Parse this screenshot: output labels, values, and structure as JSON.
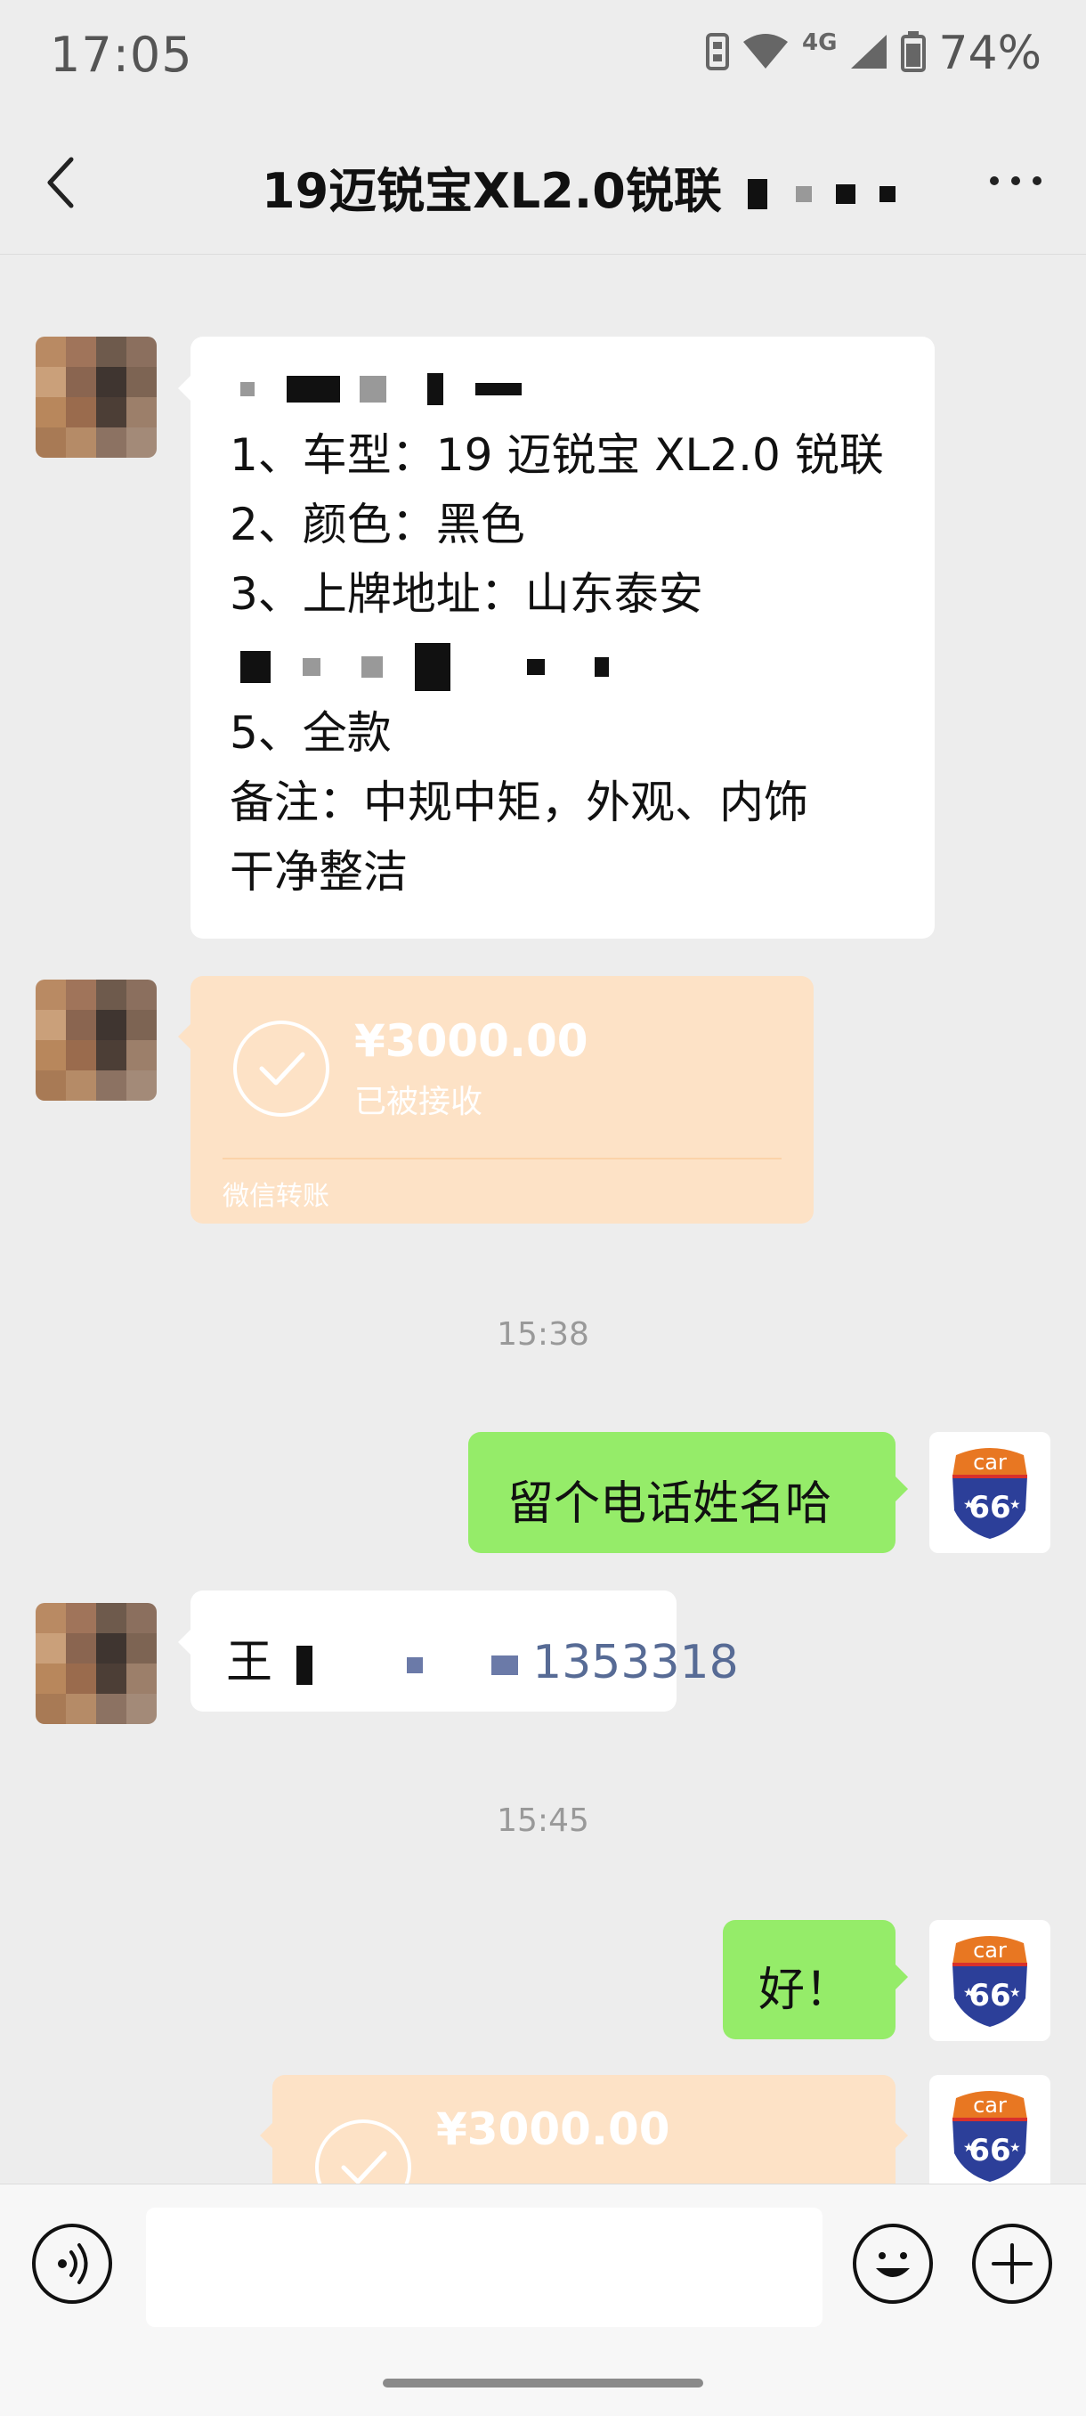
{
  "status_bar": {
    "time": "17:05",
    "network": "4G",
    "battery": "74%"
  },
  "header": {
    "title": "19迈锐宝XL2.0锐联"
  },
  "messages": {
    "order_lines": [
      "1、车型：19 迈锐宝 XL2.0 锐联",
      "2、颜色：黑色",
      "3、上牌地址：山东泰安",
      "5、全款",
      "备注：中规中矩，外观、内饰",
      "干净整洁"
    ],
    "transfer_1": {
      "amount": "¥3000.00",
      "status": "已被接收",
      "label": "微信转账"
    },
    "time_1": "15:38",
    "reply_1": "留个电话姓名哈",
    "contact_prefix": "王",
    "contact_phone": "1353318",
    "time_2": "15:45",
    "reply_2": "好！",
    "transfer_2": {
      "amount": "¥3000.00"
    }
  },
  "avatar_self": {
    "brand_text": "car",
    "number": "66",
    "colors": {
      "top": "#e87722",
      "shield": "#2c3f99",
      "red": "#d8302c"
    }
  },
  "colors": {
    "bubble_green": "#95ec69",
    "transfer_bg": "#fde2c6",
    "background": "#ededed"
  }
}
